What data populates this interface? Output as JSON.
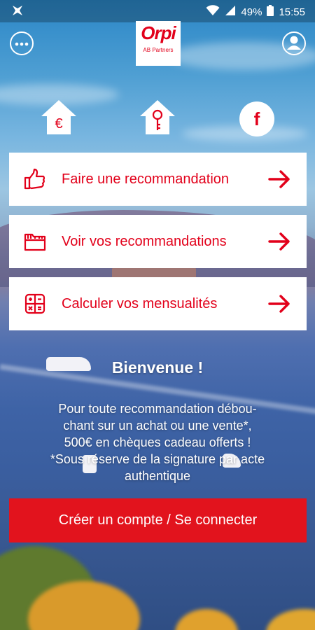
{
  "status_bar": {
    "battery": "49%",
    "time": "15:55"
  },
  "header": {
    "menu_icon": "more-dots-icon",
    "logo_brand": "Orpi",
    "logo_sub": "AB Partners",
    "profile_icon": "user-icon"
  },
  "quick_actions": [
    {
      "icon": "house-euro-icon"
    },
    {
      "icon": "house-key-icon"
    },
    {
      "icon": "facebook-icon",
      "glyph": "f"
    }
  ],
  "cards": [
    {
      "label": "Faire une recommandation",
      "icon": "thumbs-up-icon"
    },
    {
      "label": "Voir vos recommandations",
      "icon": "folder-icon"
    },
    {
      "label": "Calculer vos mensualités",
      "icon": "calculator-icon"
    }
  ],
  "welcome": {
    "title": "Bienvenue !",
    "line1": "Pour toute recommandation débou-",
    "line2": "chant sur un achat ou une vente*,",
    "line3": "500€ en chèques cadeau offerts !",
    "line4": "*Sous réserve de la signature par acte",
    "line5": "authentique"
  },
  "cta_label": "Créer un compte / Se connecter",
  "colors": {
    "accent": "#e2001a",
    "cta": "#e2131d"
  }
}
